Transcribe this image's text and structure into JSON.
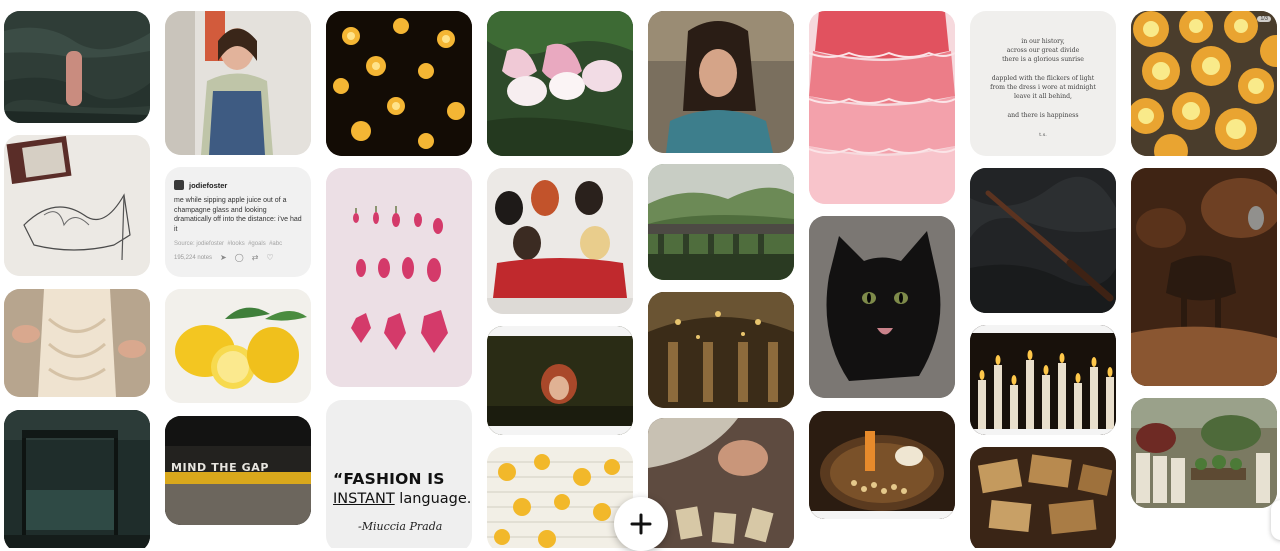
{
  "pins": [
    {
      "name": "green-knit-sweater-pin"
    },
    {
      "name": "fashion-shoe-sketch-pin"
    },
    {
      "name": "dress-form-tailoring-pin"
    },
    {
      "name": "dark-canopy-bedroom-pin"
    },
    {
      "name": "woman-denim-overalls-pin"
    },
    {
      "name": "lemons-painting-pin"
    },
    {
      "name": "mind-the-gap-pin"
    },
    {
      "name": "star-fairy-lights-pin"
    },
    {
      "name": "pink-buds-flatlay-pin"
    },
    {
      "name": "fuchsia-flowers-pin"
    },
    {
      "name": "spice-girls-pin"
    },
    {
      "name": "red-hair-night-pin"
    },
    {
      "name": "yellow-flower-book-pin"
    },
    {
      "name": "woman-teal-shirt-pin"
    },
    {
      "name": "green-hills-viaduct-pin"
    },
    {
      "name": "great-hall-pin"
    },
    {
      "name": "tarot-cards-hands-pin"
    },
    {
      "name": "pink-ruffle-dress-pin"
    },
    {
      "name": "black-cat-pin"
    },
    {
      "name": "candle-tray-pin"
    },
    {
      "name": "magic-wand-pin"
    },
    {
      "name": "candles-pin"
    },
    {
      "name": "tarot-table-pin"
    },
    {
      "name": "lemon-cakes-pin"
    },
    {
      "name": "cauldron-pin"
    },
    {
      "name": "greenhouse-pin"
    }
  ],
  "tweet_pin": {
    "username": "jodiefoster",
    "text": "me while sipping apple juice out of a champagne glass and looking dramatically off into the distance: i've had it",
    "source": "Source: jodiefoster",
    "tags": [
      "#looks",
      "#goals",
      "#abc"
    ],
    "notes": "195,224 notes"
  },
  "quote_pin": {
    "line1": "“FASHION IS",
    "line2_underlined": "INSTANT",
    "line2_rest": " language.”",
    "author": "-Miuccia Prada"
  },
  "poem_pin": {
    "lines": [
      "in our history,",
      "across our great divide",
      "there is a glorious sunrise",
      "",
      "dappled with the flickers of light",
      "from the dress i wore at midnight",
      "leave it all behind,",
      "",
      "and there is happiness"
    ],
    "signature": "t.s."
  },
  "sign_pin": {
    "text": "MIND THE GAP"
  },
  "cakes_pin": {
    "counter": "1/3"
  },
  "fab": {
    "label": "+",
    "icon": "plus-icon"
  },
  "colors": {
    "background": "#ffffff",
    "fab": "#ffffff"
  }
}
